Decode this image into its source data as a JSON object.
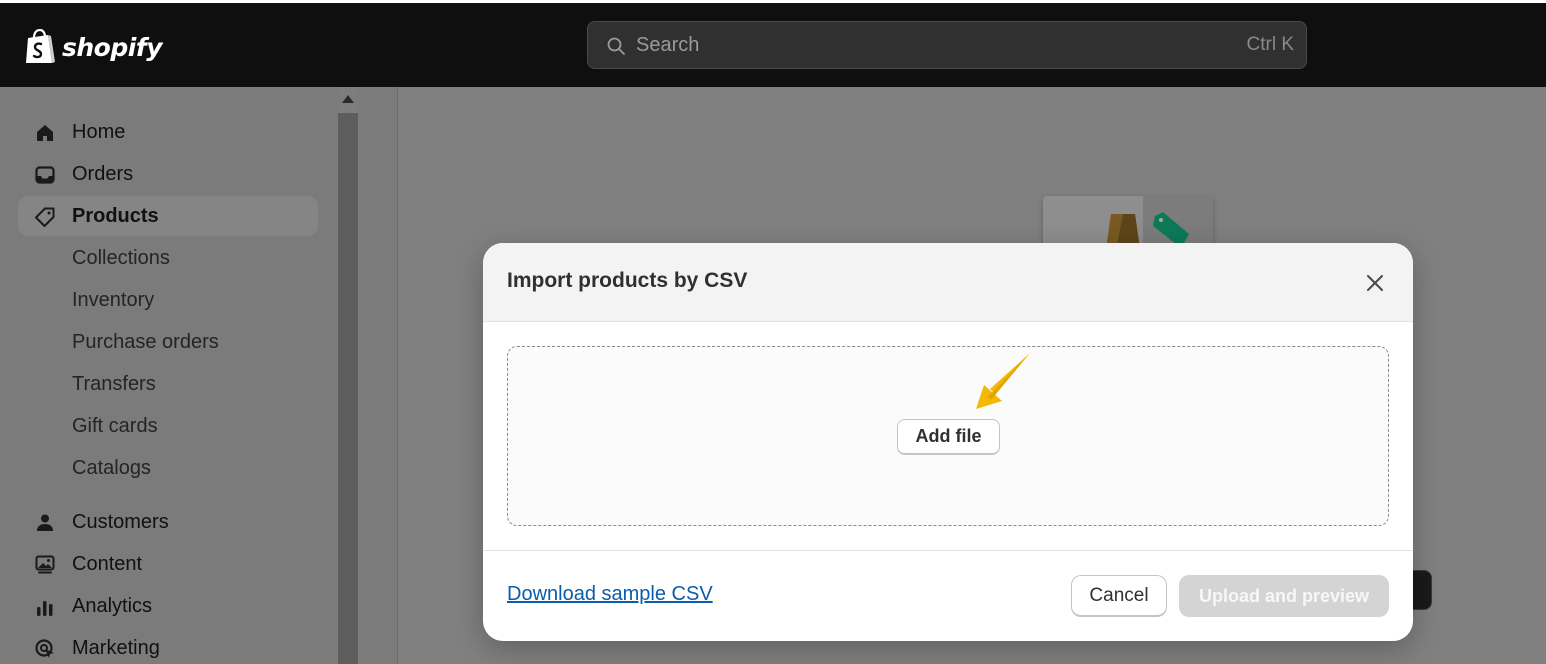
{
  "topbar": {
    "logo_text": "shopify",
    "search": {
      "placeholder": "Search",
      "shortcut": "Ctrl K"
    }
  },
  "sidebar": {
    "items": [
      {
        "label": "Home",
        "icon": "home-icon"
      },
      {
        "label": "Orders",
        "icon": "inbox-icon"
      },
      {
        "label": "Products",
        "icon": "tag-icon",
        "active": true
      },
      {
        "label": "Collections"
      },
      {
        "label": "Inventory"
      },
      {
        "label": "Purchase orders"
      },
      {
        "label": "Transfers"
      },
      {
        "label": "Gift cards"
      },
      {
        "label": "Catalogs"
      },
      {
        "label": "Customers",
        "icon": "person-icon"
      },
      {
        "label": "Content",
        "icon": "image-icon"
      },
      {
        "label": "Analytics",
        "icon": "bar-chart-icon"
      },
      {
        "label": "Marketing",
        "icon": "target-icon"
      }
    ]
  },
  "modal": {
    "title": "Import products by CSV",
    "add_file_label": "Add file",
    "download_link": "Download sample CSV",
    "cancel_label": "Cancel",
    "upload_label": "Upload and preview"
  },
  "colors": {
    "topbar_bg": "#0f0f0f",
    "link": "#0b5cad",
    "annotation_arrow": "#f5b800",
    "disabled_button": "#d4d4d4",
    "tag_green": "#0d7a57"
  }
}
